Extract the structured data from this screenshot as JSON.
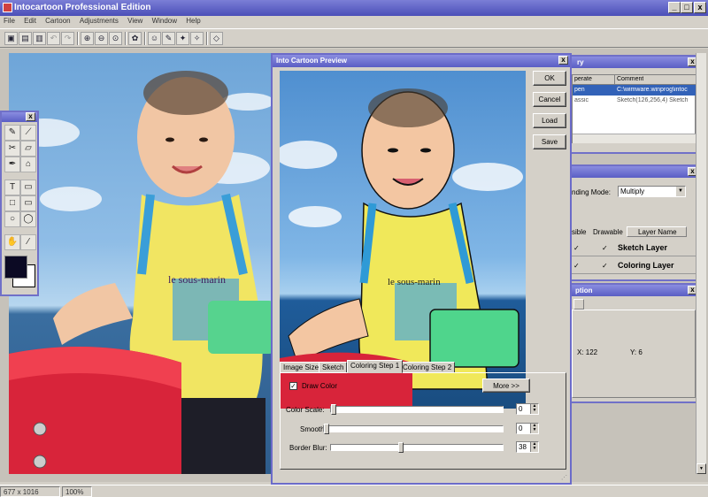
{
  "app": {
    "title": "Intocartoon Professional Edition"
  },
  "window_buttons": {
    "minimize": "_",
    "maximize": "□",
    "close": "x"
  },
  "menu": [
    "File",
    "Edit",
    "Cartoon",
    "Adjustments",
    "View",
    "Window",
    "Help"
  ],
  "toolbar_icons": [
    "open-icon",
    "save-icon",
    "save-as-icon",
    "undo-icon",
    "redo-icon",
    "zoom-in-icon",
    "zoom-out-icon",
    "zoom-fit-icon",
    "paint-icon",
    "cartoon-icon",
    "sketch-icon",
    "coloring-icon",
    "filter-icon",
    "eraser-icon"
  ],
  "tools": {
    "icons": [
      "pencil-icon",
      "brush-icon",
      "fill-icon",
      "eraser-icon",
      "smudge-icon",
      "stamp-icon",
      "text-icon",
      "callout-icon",
      "rectangle-icon",
      "rounded-callout-icon",
      "ellipse-icon",
      "speech-bubble-icon",
      "hand-icon",
      "eyedropper-icon"
    ],
    "glyphs": [
      "✎",
      "⟋",
      "✂",
      "▱",
      "✒",
      "⌂",
      "T",
      "▭",
      "□",
      "▭",
      "○",
      "◯",
      "✋",
      "⁄"
    ],
    "fg_color": "#0c0a24",
    "bg_color": "#ffffff"
  },
  "status": {
    "dimensions": "677 x 1016",
    "zoom": "100%"
  },
  "history": {
    "title_partial": "ry",
    "columns": [
      "perate",
      "Comment"
    ],
    "rows": [
      {
        "op": "pen",
        "comment": "C:\\wimware.winprog\\intoc"
      },
      {
        "op": "assic",
        "comment": "Sketch(126,256,4) Sketch"
      }
    ]
  },
  "layers": {
    "blending_label": "nding Mode:",
    "blending_value": "Multiply",
    "col_visible": "sible",
    "col_drawable": "Drawable",
    "col_name": "Layer Name",
    "rows": [
      {
        "name": "Sketch Layer"
      },
      {
        "name": "Coloring Layer"
      }
    ],
    "check": "✓"
  },
  "info": {
    "title_partial": "ption",
    "x_label": "X: 122",
    "y_label": "Y: 6"
  },
  "preview": {
    "title": "Into Cartoon Preview",
    "close": "x",
    "buttons": {
      "ok": "OK",
      "cancel": "Cancel",
      "load": "Load",
      "save": "Save"
    },
    "tabs": [
      "Image Size",
      "Sketch",
      "Coloring Step 1",
      "Coloring Step 2"
    ],
    "draw_color_label": "Draw Color",
    "draw_color_check": "✓",
    "more_button": "More >>",
    "color_scale_label": "Color Scale:",
    "color_scale_value": "0",
    "smooth_label": "Smooth:",
    "smooth_value": "0",
    "border_blur_label": "Border Blur:",
    "border_blur_value": "38"
  }
}
